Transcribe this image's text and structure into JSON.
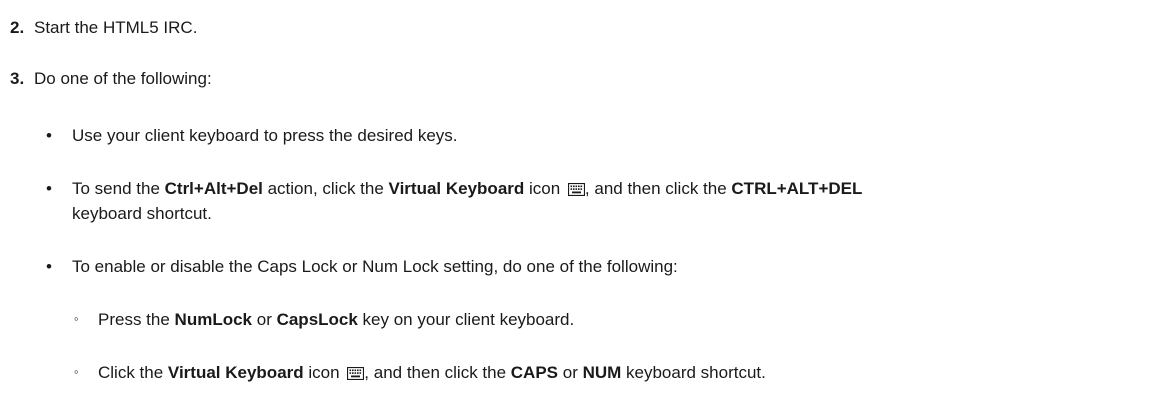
{
  "steps": [
    {
      "number": "2.",
      "text": "Start the HTML5 IRC."
    },
    {
      "number": "3.",
      "text": "Do one of the following:"
    }
  ],
  "bullets": {
    "b1": {
      "text": "Use your client keyboard to press the desired keys."
    },
    "b2": {
      "t1": "To send the ",
      "bold1": "Ctrl+Alt+Del",
      "t2": " action, click the ",
      "bold2": "Virtual Keyboard",
      "t3": " icon ",
      "t4": ", and then click the ",
      "bold3": "CTRL+ALT+DEL",
      "t5": "keyboard shortcut."
    },
    "b3": {
      "text": "To enable or disable the Caps Lock or Num Lock setting, do one of the following:"
    }
  },
  "subbullets": {
    "s1": {
      "t1": "Press the ",
      "bold1": "NumLock",
      "t2": " or ",
      "bold2": "CapsLock",
      "t3": " key on your client keyboard."
    },
    "s2": {
      "t1": "Click the ",
      "bold1": "Virtual Keyboard",
      "t2": " icon ",
      "t3": ", and then click the ",
      "bold2": "CAPS",
      "t4": " or ",
      "bold3": "NUM",
      "t5": " keyboard shortcut."
    }
  },
  "marks": {
    "bullet": "•",
    "sub": "◦"
  },
  "icons": {
    "virtual_keyboard": "keyboard-icon"
  }
}
